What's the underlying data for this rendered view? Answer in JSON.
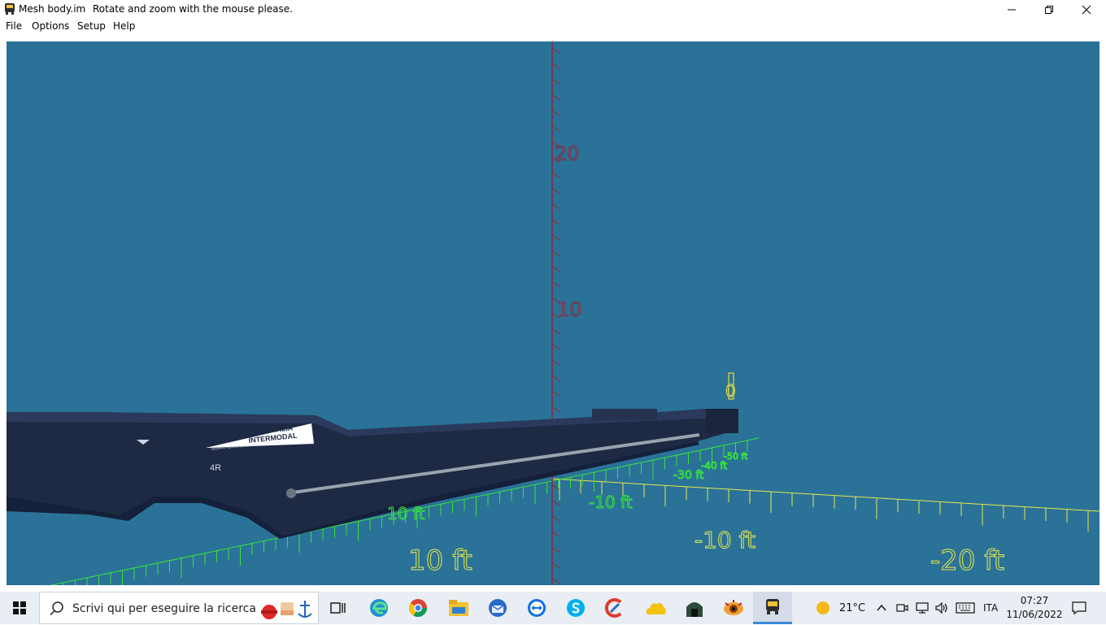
{
  "window": {
    "title": "Mesh body.im",
    "hint": "Rotate and zoom with the mouse please.",
    "minimize_icon": "minimize-icon",
    "maximize_icon": "restore-icon",
    "close_icon": "close-icon"
  },
  "menu": {
    "items": [
      "File",
      "Options",
      "Setup",
      "Help"
    ]
  },
  "viewport": {
    "background": "#2a7298",
    "vertical_axis_labels": [
      "20",
      "10",
      "0"
    ],
    "ground_labels_yellow": [
      "10 ft",
      "-10 ft",
      "-20 ft"
    ],
    "ground_labels_green": [
      "10 ft",
      "-10 ft",
      "-30 ft",
      "-40 ft",
      "-50 ft"
    ],
    "axis_colors": {
      "vertical": "#8a2b3a",
      "yellow_axis": "#e6e84a",
      "green_axis": "#39e33a"
    },
    "wagon": {
      "logo_line1": "MERCITALIA",
      "logo_line2": "INTERMODAL",
      "logo_sub": "GRUPPO FERROVIE DELLO STATO ITALIANE",
      "marking": "4R"
    }
  },
  "taskbar": {
    "search_placeholder": "Scrivi qui per eseguire la ricerca",
    "apps": [
      "task-view-icon",
      "edge-icon",
      "chrome-icon",
      "file-explorer-icon",
      "thunderbird-icon",
      "teamviewer-icon",
      "skype-icon",
      "ccleaner-icon",
      "onedrive-icon",
      "train-depot-icon",
      "eye-app-icon",
      "mesh-viewer-icon"
    ],
    "weather": "21°C",
    "language": "ITA",
    "time": "07:27",
    "date": "11/06/2022"
  }
}
